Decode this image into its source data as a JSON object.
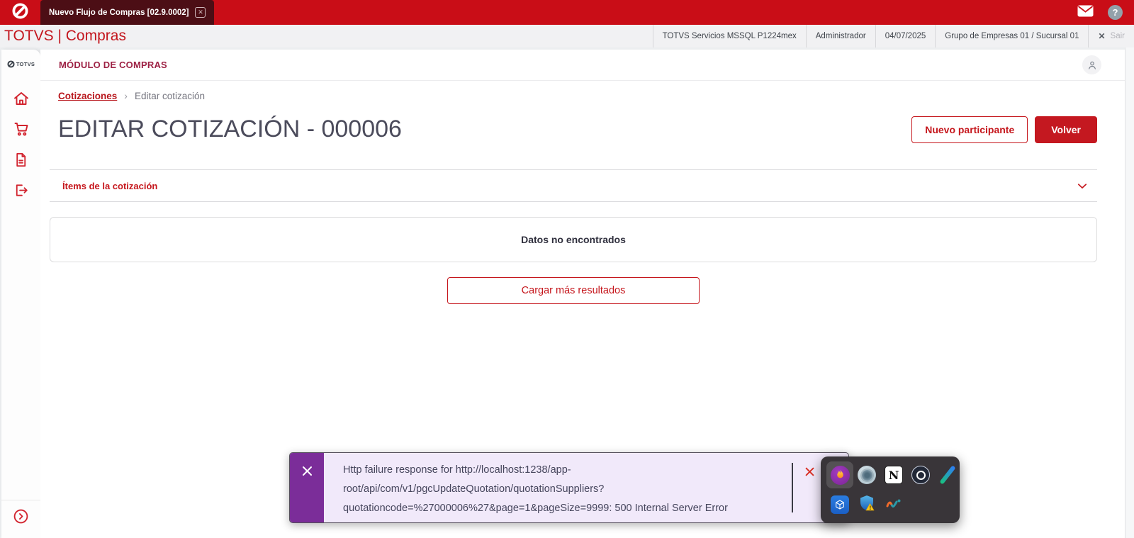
{
  "titlebar": {
    "tab_title": "Nuevo Flujo de Compras [02.9.0002]",
    "tab_close_glyph": "✕",
    "help_glyph": "?",
    "icons": [
      "totvs-logo",
      "mail",
      "help"
    ]
  },
  "appbar": {
    "brand": "TOTVS | Compras",
    "info_items": [
      "TOTVS Servicios MSSQL P1224mex",
      "Administrador",
      "04/07/2025",
      "Grupo de Empresas 01 / Sucursal 01"
    ],
    "logout": {
      "glyph": "✕",
      "label": "Sair"
    }
  },
  "sidebar": {
    "logo_text": "TOTVS",
    "icons": [
      "home",
      "shopping-cart",
      "document",
      "logout",
      "chevron-right-circle"
    ]
  },
  "module_header": {
    "title": "MÓDULO DE COMPRAS",
    "icon": "user"
  },
  "breadcrumb": {
    "parent": "Cotizaciones",
    "separator": "›",
    "current": "Editar cotización"
  },
  "page": {
    "title": "EDITAR COTIZACIÓN - 000006",
    "secondary_button": "Nuevo participante",
    "primary_button": "Volver"
  },
  "section": {
    "title": "Ítems de la cotización",
    "icon": "chevron-down"
  },
  "results": {
    "empty_message": "Datos no encontrados",
    "load_more_label": "Cargar más resultados"
  },
  "toast": {
    "type": "error",
    "accent_color": "#7b2d99",
    "background_color": "#f1e9fa",
    "message": "Http failure response for http://localhost:1238/app-root/api/com/v1/pgcUpdateQuotation/quotationSuppliers?quotationcode=%27000006%27&page=1&pageSize=9999: 500 Internal Server Error",
    "message_lines": [
      "Http failure response for http://localhost:1238/app-",
      "root/api/com/v1/pgcUpdateQuotation/quotationSuppliers?",
      "quotationcode=%27000006%27&page=1&pageSize=9999: 500 Internal Server Error"
    ]
  },
  "dock": {
    "notion_letter": "N",
    "row1": [
      "flame-app",
      "gear-sphere-app",
      "notion-app",
      "ring-app",
      "pen-app"
    ],
    "row2": [
      "cube-app",
      "security-shield-alert",
      "squiggle-app"
    ]
  },
  "colors": {
    "brand_red": "#c5161c",
    "titlebar_red": "#c90d17",
    "tab_maroon": "#4c0e15",
    "toast_purple": "#7b2d99"
  }
}
